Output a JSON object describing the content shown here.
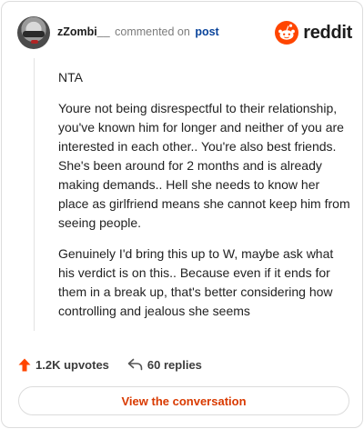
{
  "comment": {
    "username": "zZombi__",
    "action_text": "commented on",
    "target_text": "post",
    "paragraphs": [
      "NTA",
      "Youre not being disrespectful to their relationship, you've known him for longer and neither of you are interested in each other.. You're also best friends. She's been around for 2 months and is already making demands.. Hell she needs to know her place as girlfriend means she cannot keep him from seeing people.",
      "Genuinely I'd bring this up to W, maybe ask what his verdict is on this.. Because even if it ends for them in a break up, that's better considering how controlling and jealous she seems"
    ]
  },
  "brand": {
    "wordmark": "reddit",
    "icon": "reddit-snoo-icon",
    "color": "#ff4500"
  },
  "stats": {
    "upvotes_label": "1.2K upvotes",
    "upvote_icon": "upvote-arrow-icon",
    "upvote_color": "#ff4500",
    "replies_label": "60 replies",
    "reply_icon": "reply-arrow-icon"
  },
  "cta": {
    "label": "View the conversation",
    "color": "#d93a00"
  }
}
